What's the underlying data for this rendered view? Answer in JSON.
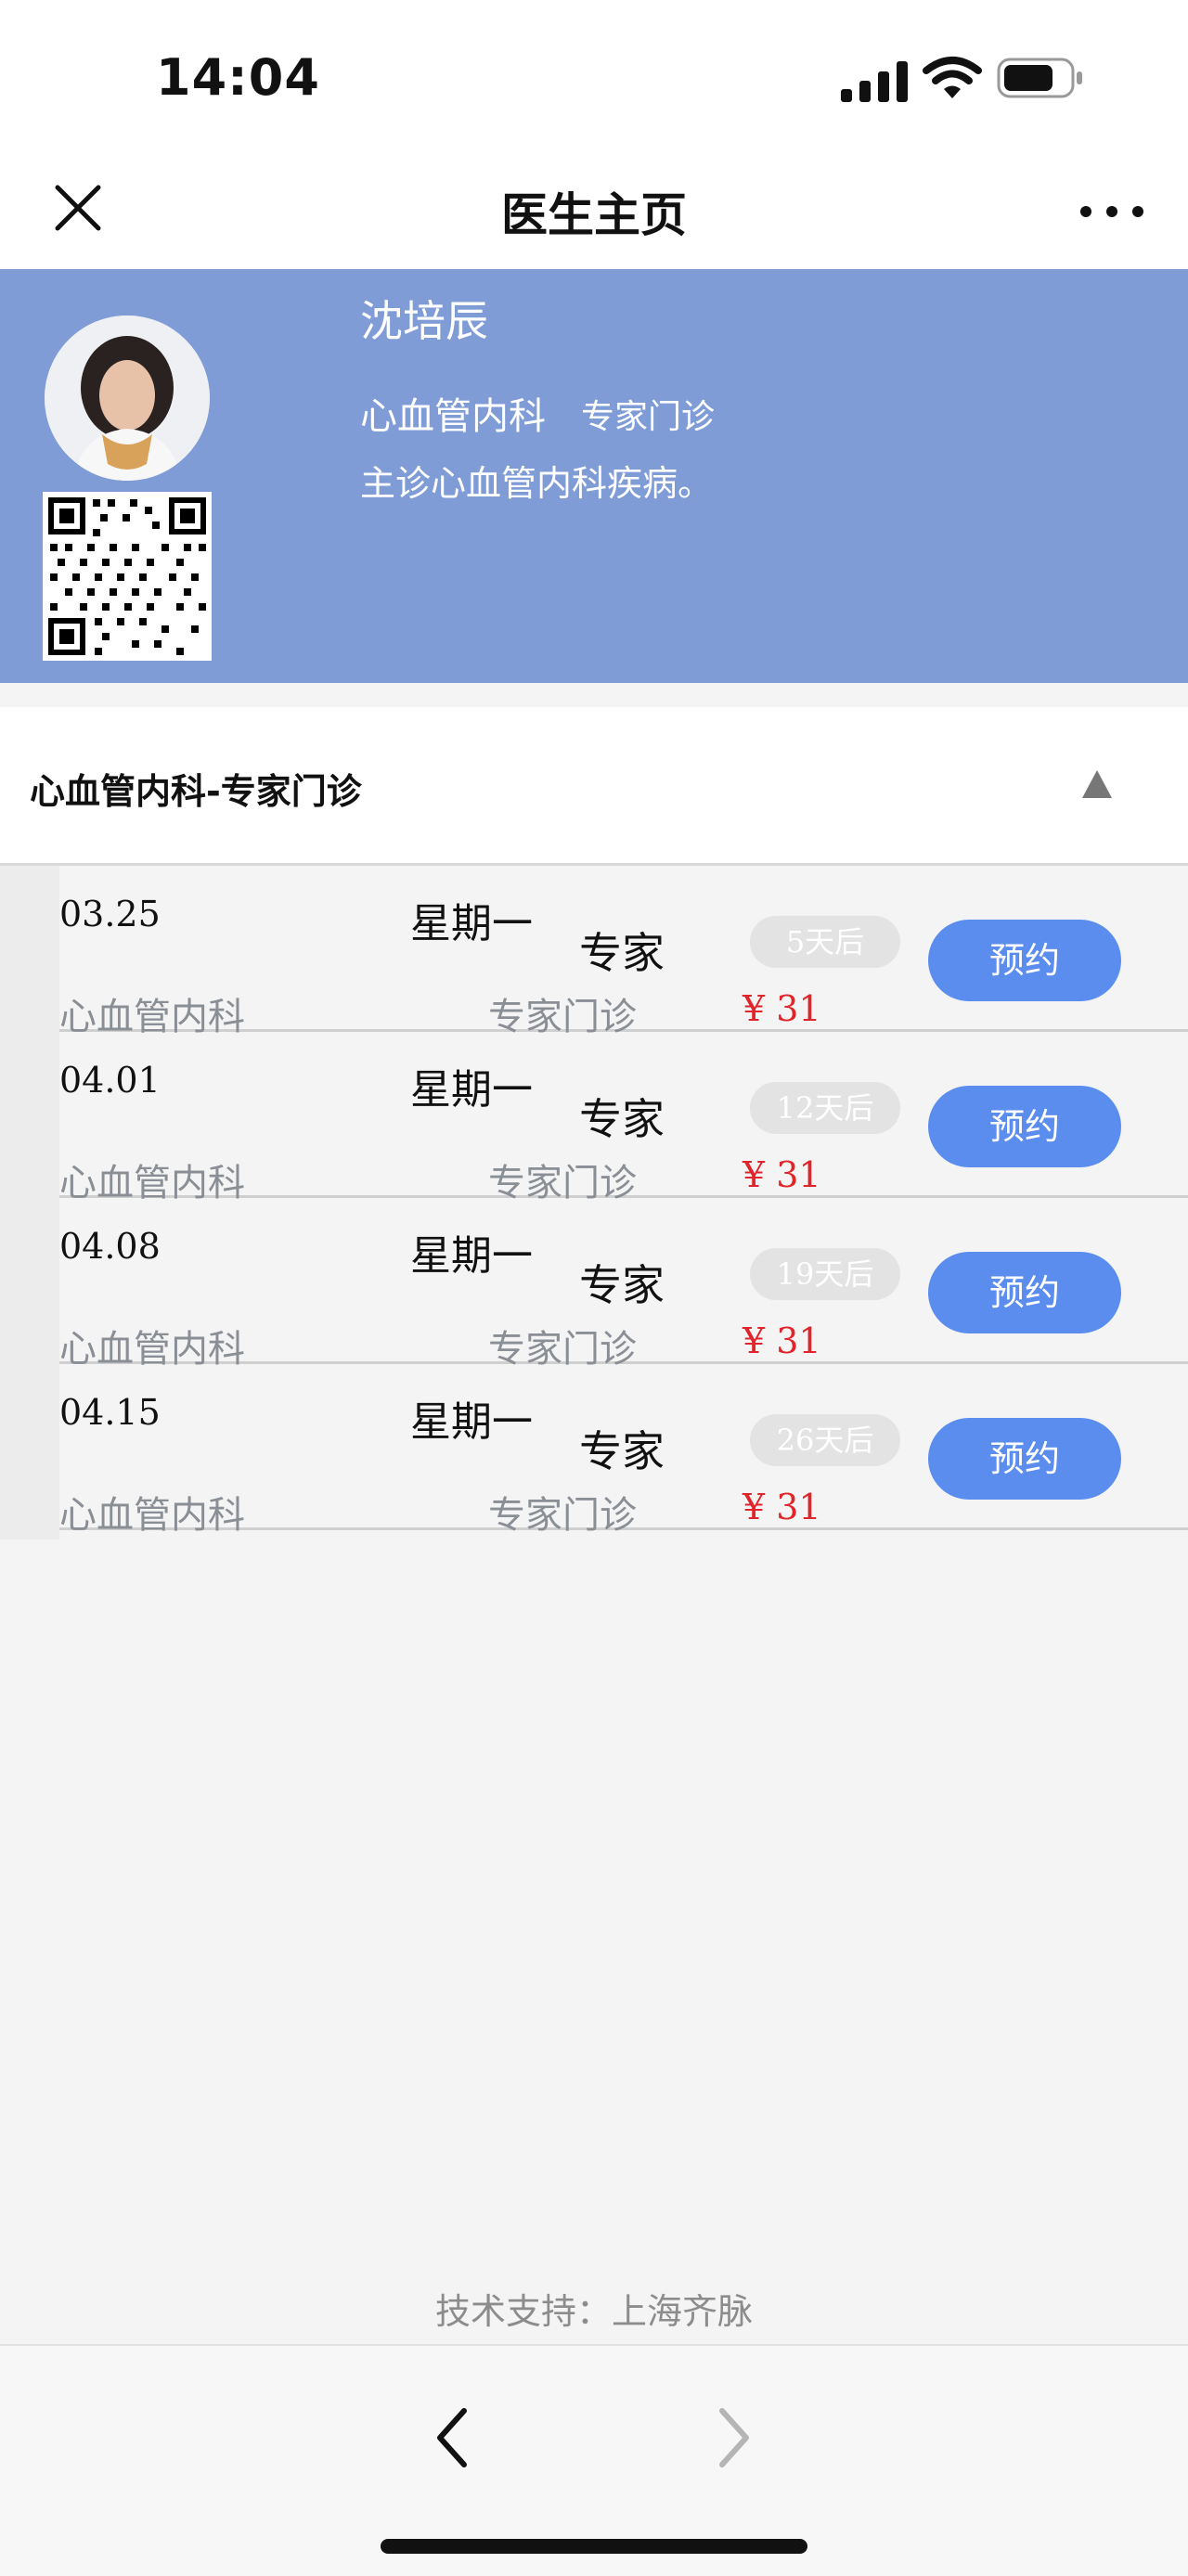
{
  "status_bar": {
    "time": "14:04"
  },
  "nav": {
    "title": "医生主页",
    "close_icon": "close-icon",
    "more_icon": "more-dots-icon"
  },
  "doctor": {
    "name": "沈培辰",
    "department": "心血管内科",
    "clinic_type": "专家门诊",
    "description": "主诊心血管内科疾病。"
  },
  "section": {
    "title": "心血管内科-专家门诊",
    "toggle_icon": "triangle-up-icon"
  },
  "schedule": [
    {
      "date": "03.25",
      "weekday": "星期一",
      "level": "专家",
      "countdown": "5天后",
      "book_label": "预约",
      "department": "心血管内科",
      "clinic": "专家门诊",
      "price": "¥ 31"
    },
    {
      "date": "04.01",
      "weekday": "星期一",
      "level": "专家",
      "countdown": "12天后",
      "book_label": "预约",
      "department": "心血管内科",
      "clinic": "专家门诊",
      "price": "¥ 31"
    },
    {
      "date": "04.08",
      "weekday": "星期一",
      "level": "专家",
      "countdown": "19天后",
      "book_label": "预约",
      "department": "心血管内科",
      "clinic": "专家门诊",
      "price": "¥ 31"
    },
    {
      "date": "04.15",
      "weekday": "星期一",
      "level": "专家",
      "countdown": "26天后",
      "book_label": "预约",
      "department": "心血管内科",
      "clinic": "专家门诊",
      "price": "¥ 31"
    }
  ],
  "footer": {
    "note": "技术支持：上海齐脉"
  },
  "colors": {
    "header_blue": "#7f9cd6",
    "button_blue": "#5b8def",
    "price_red": "#e0242a"
  }
}
